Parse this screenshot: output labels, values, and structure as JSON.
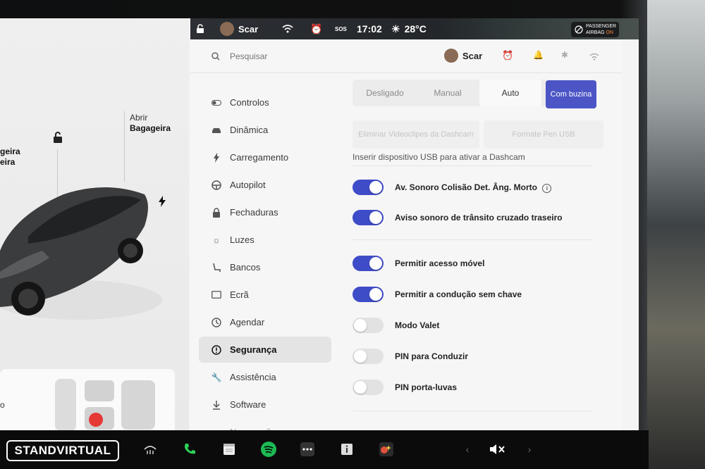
{
  "status": {
    "profile_name": "Scar",
    "time": "17:02",
    "temperature": "28°C",
    "sos": "SOS",
    "airbag_line1": "PASSENGER",
    "airbag_line2": "AIRBAG",
    "airbag_state": "ON"
  },
  "car": {
    "trunk_line1": "Abrir",
    "trunk_line2": "Bagageira",
    "frunk_line1": "geira",
    "frunk_line2": "eira",
    "seat_fragment": "o"
  },
  "header": {
    "search_placeholder": "Pesquisar",
    "profile_name": "Scar"
  },
  "menu": {
    "items": [
      {
        "label": "Controlos",
        "icon": "toggle-icon"
      },
      {
        "label": "Dinâmica",
        "icon": "car-icon"
      },
      {
        "label": "Carregamento",
        "icon": "bolt-icon"
      },
      {
        "label": "Autopilot",
        "icon": "steering-wheel-icon"
      },
      {
        "label": "Fechaduras",
        "icon": "lock-icon"
      },
      {
        "label": "Luzes",
        "icon": "light-icon"
      },
      {
        "label": "Bancos",
        "icon": "seat-icon"
      },
      {
        "label": "Ecrã",
        "icon": "display-icon"
      },
      {
        "label": "Agendar",
        "icon": "clock-icon"
      },
      {
        "label": "Segurança",
        "icon": "alert-icon",
        "active": true
      },
      {
        "label": "Assistência",
        "icon": "wrench-icon"
      },
      {
        "label": "Software",
        "icon": "download-icon"
      },
      {
        "label": "Navegação",
        "icon": "navigation-icon"
      }
    ]
  },
  "sentry": {
    "options": [
      "Desligado",
      "Manual",
      "Auto",
      "Com buzina"
    ],
    "selected": "Com buzina",
    "delete_clips": "Eliminar Videoclipes da Dashcam",
    "format_usb": "Formate Pen USB",
    "usb_hint": "Inserir dispositivo USB para ativar a Dashcam"
  },
  "toggles": [
    {
      "label": "Av. Sonoro Colisão Det. Âng. Morto",
      "on": true,
      "info": true
    },
    {
      "label": "Aviso sonoro de trânsito cruzado traseiro",
      "on": true
    },
    {
      "label": "Permitir acesso móvel",
      "on": true
    },
    {
      "label": "Permitir a condução sem chave",
      "on": true
    },
    {
      "label": "Modo Valet",
      "on": false
    },
    {
      "label": "PIN para Conduzir",
      "on": false
    },
    {
      "label": "PIN porta-luvas",
      "on": false
    }
  ],
  "dock": {
    "brand": "STANDVIRTUAL",
    "volume_state": "muted"
  },
  "colors": {
    "accent": "#3f4cc8",
    "phone_green": "#2ed158",
    "spotify_green": "#1db954"
  }
}
